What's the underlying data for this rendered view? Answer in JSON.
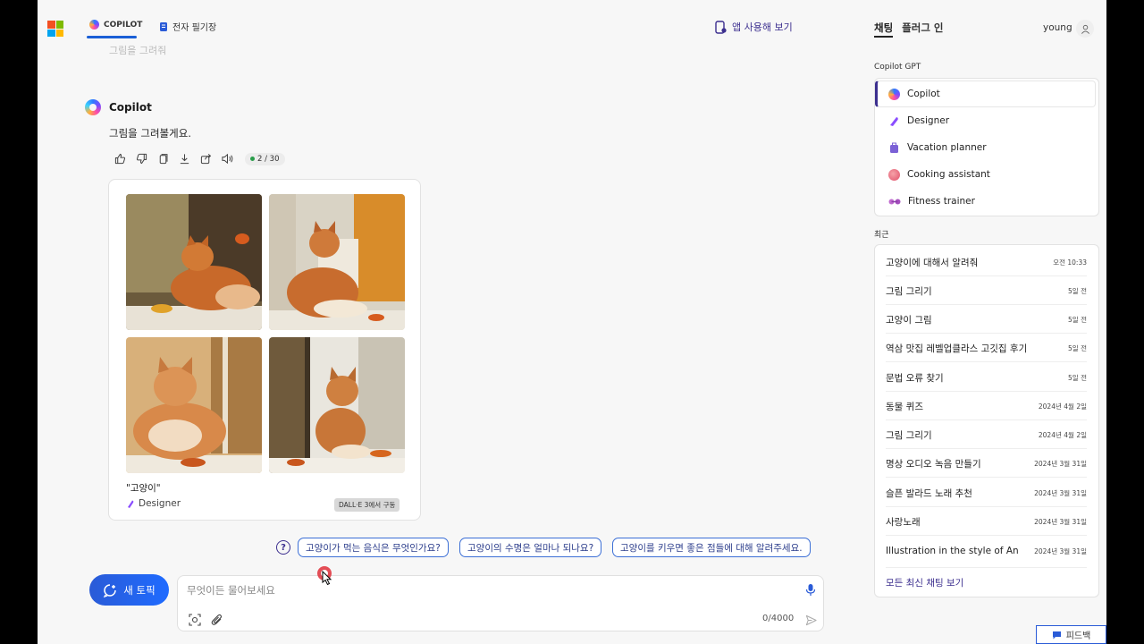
{
  "header": {
    "tabs": [
      {
        "label": "COPILOT",
        "active": true
      },
      {
        "label": "전자 필기장",
        "active": false
      }
    ],
    "app_link": "앱 사용해 보기"
  },
  "chat": {
    "cropped_prev_text": "그림을 그려줘",
    "bot_name": "Copilot",
    "bot_message": "그림을 그려볼게요.",
    "counter": "2 / 30",
    "image_card": {
      "title": "\"고양이\"",
      "creator": "Designer",
      "badge": "DALL·E 3에서 구동"
    }
  },
  "suggestions": {
    "items": [
      "고양이가 먹는 음식은 무엇인가요?",
      "고양이의 수명은 얼마나 되나요?",
      "고양이를 키우면 좋은 점들에 대해 알려주세요."
    ]
  },
  "composer": {
    "new_topic": "새 토픽",
    "placeholder": "무엇이든 물어보세요",
    "char_count": "0/4000"
  },
  "sidebar": {
    "tabs": [
      "채팅",
      "플러그 인"
    ],
    "user": "young",
    "gpt_label": "Copilot GPT",
    "gpts": [
      {
        "label": "Copilot",
        "color": "#5b6cff"
      },
      {
        "label": "Designer",
        "color": "#8a4dff"
      },
      {
        "label": "Vacation planner",
        "color": "#7b61d6"
      },
      {
        "label": "Cooking assistant",
        "color": "#e0506a"
      },
      {
        "label": "Fitness trainer",
        "color": "#c06acf"
      }
    ],
    "recent_label": "최근",
    "recent": [
      {
        "label": "고양이에 대해서 알려줘",
        "date": "오전 10:33"
      },
      {
        "label": "그림 그리기",
        "date": "5일 전"
      },
      {
        "label": "고양이 그림",
        "date": "5일 전"
      },
      {
        "label": "역삼 맛집 레벨업클라스 고깃집 후기",
        "date": "5일 전"
      },
      {
        "label": "문법 오류 찾기",
        "date": "5일 전"
      },
      {
        "label": "동물 퀴즈",
        "date": "2024년 4월 2일"
      },
      {
        "label": "그림 그리기",
        "date": "2024년 4월 2일"
      },
      {
        "label": "명상 오디오 녹음 만들기",
        "date": "2024년 3월 31일"
      },
      {
        "label": "슬픈 발라드 노래 추천",
        "date": "2024년 3월 31일"
      },
      {
        "label": "사랑노래",
        "date": "2024년 3월 31일"
      },
      {
        "label": "Illustration in the style of Andy Warhol",
        "date": "2024년 3월 31일"
      }
    ],
    "see_all": "모든 최신 채팅 보기"
  },
  "feedback": "피드백",
  "colors": {
    "accent": "#2a5bd7",
    "brand_purple": "#3c2f8f"
  }
}
